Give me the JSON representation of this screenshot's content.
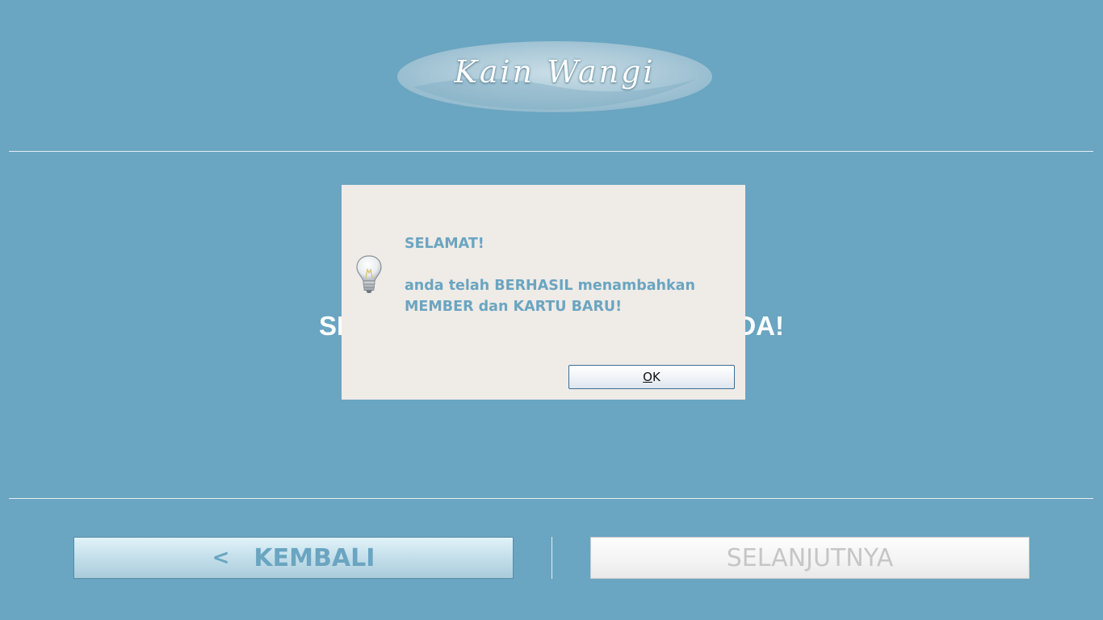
{
  "app": {
    "logo_text": "Kain Wangi",
    "background_color": "#6aa5c1"
  },
  "main": {
    "headline_visible_left": "SE",
    "headline_visible_right": "DA!"
  },
  "dialog": {
    "icon": "lightbulb-icon",
    "title": "SELAMAT!",
    "message_line1": "anda telah BERHASIL menambahkan",
    "message_line2": "MEMBER dan KARTU BARU!",
    "ok_mnemonic": "O",
    "ok_rest": "K"
  },
  "footer": {
    "back_icon": "<",
    "back_label": "KEMBALI",
    "next_label": "SELANJUTNYA",
    "next_enabled": false
  }
}
